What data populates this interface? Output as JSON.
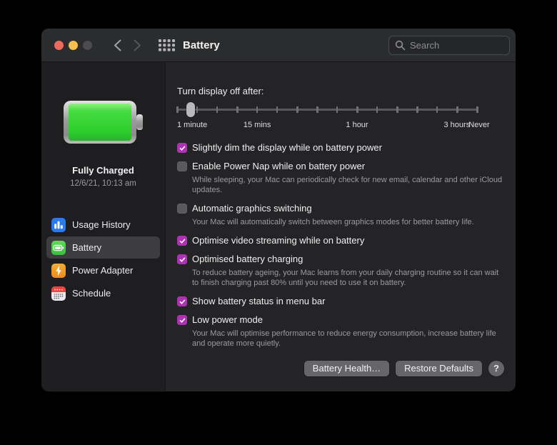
{
  "window": {
    "title": "Battery"
  },
  "toolbar": {
    "search_placeholder": "Search"
  },
  "sidebar": {
    "status": {
      "title": "Fully Charged",
      "subtitle": "12/6/21, 10:13 am"
    },
    "items": [
      {
        "label": "Usage History",
        "icon": "bar-chart-icon",
        "selected": false
      },
      {
        "label": "Battery",
        "icon": "battery-icon",
        "selected": true
      },
      {
        "label": "Power Adapter",
        "icon": "lightning-icon",
        "selected": false
      },
      {
        "label": "Schedule",
        "icon": "calendar-icon",
        "selected": false
      }
    ]
  },
  "content": {
    "slider": {
      "label": "Turn display off after:",
      "tick_count": 16,
      "value_percent": 4.5,
      "tick_labels": [
        {
          "text": "1 minute",
          "percent": 0,
          "align": "left"
        },
        {
          "text": "15 mins",
          "percent": 26.7,
          "align": "center"
        },
        {
          "text": "1 hour",
          "percent": 60,
          "align": "center"
        },
        {
          "text": "3 hours",
          "percent": 93.3,
          "align": "center"
        },
        {
          "text": "Never",
          "percent": 100,
          "align": "right"
        }
      ]
    },
    "checkboxes": [
      {
        "label": "Slightly dim the display while on battery power",
        "checked": true,
        "description": ""
      },
      {
        "label": "Enable Power Nap while on battery power",
        "checked": false,
        "description": "While sleeping, your Mac can periodically check for new email, calendar and other iCloud updates."
      },
      {
        "label": "Automatic graphics switching",
        "checked": false,
        "description": "Your Mac will automatically switch between graphics modes for better battery life."
      },
      {
        "label": "Optimise video streaming while on battery",
        "checked": true,
        "description": ""
      },
      {
        "label": "Optimised battery charging",
        "checked": true,
        "description": "To reduce battery ageing, your Mac learns from your daily charging routine so it can wait to finish charging past 80% until you need to use it on battery."
      },
      {
        "label": "Show battery status in menu bar",
        "checked": true,
        "description": ""
      },
      {
        "label": "Low power mode",
        "checked": true,
        "description": "Your Mac will optimise performance to reduce energy consumption, increase battery life and operate more quietly."
      }
    ],
    "buttons": [
      {
        "label": "Battery Health…"
      },
      {
        "label": "Restore Defaults"
      }
    ],
    "help_label": "?"
  },
  "colors": {
    "checkbox_accent": "#b032b4",
    "battery_green": "#3ddc3d",
    "traffic_red": "#ec6a5e",
    "traffic_yellow": "#f5bf4f"
  }
}
